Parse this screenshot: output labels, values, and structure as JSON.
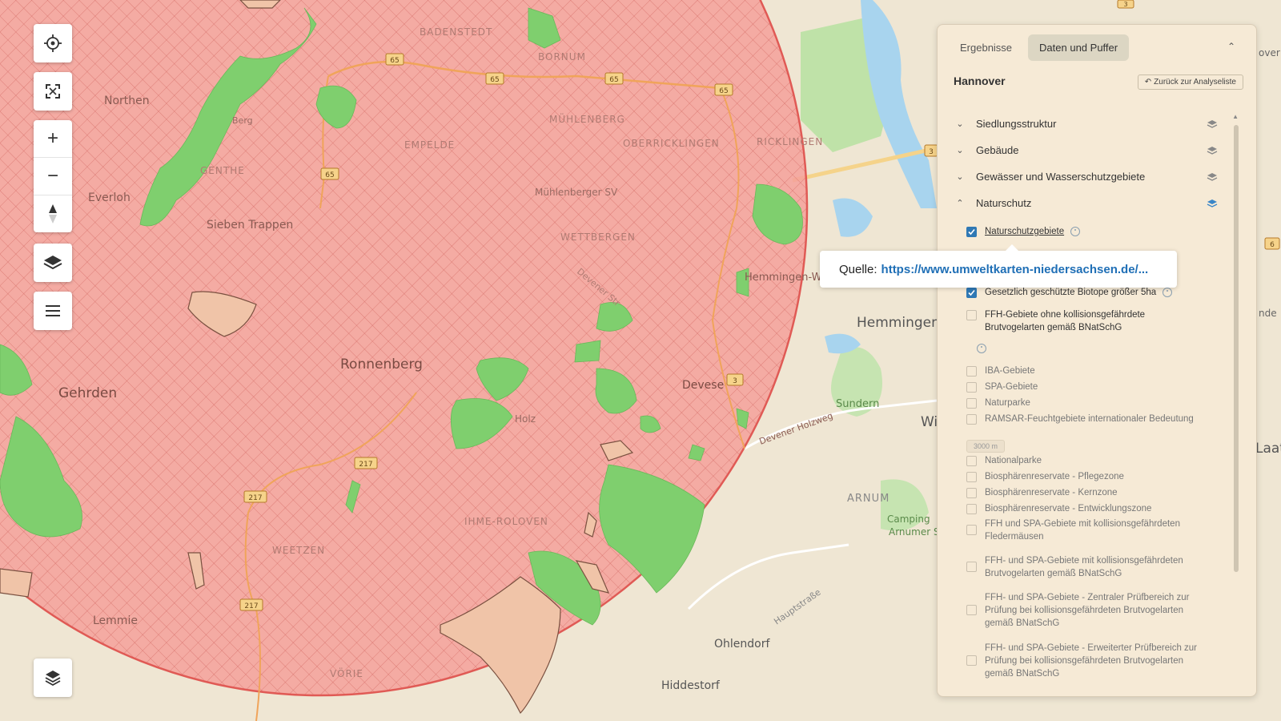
{
  "map": {
    "place_labels": [
      {
        "id": "badenstedt",
        "text": "BADENSTEDT"
      },
      {
        "id": "bornum",
        "text": "BORNUM"
      },
      {
        "id": "northen",
        "text": "Northen"
      },
      {
        "id": "berg",
        "text": "Berg"
      },
      {
        "id": "muhlenberg",
        "text": "MÜHLENBERG"
      },
      {
        "id": "empelde",
        "text": "EMPELDE"
      },
      {
        "id": "oberricklingen",
        "text": "OBERRICKLINGEN"
      },
      {
        "id": "ricklingen",
        "text": "RICKLINGEN"
      },
      {
        "id": "gehrden",
        "text": "Gehrden"
      },
      {
        "id": "genthe",
        "text": "GENTHE"
      },
      {
        "id": "everloh",
        "text": "Everloh"
      },
      {
        "id": "sieben_trappen",
        "text": "Sieben Trappen"
      },
      {
        "id": "muhlenberger_sv",
        "text": "Mühlenberger SV"
      },
      {
        "id": "wettbergen",
        "text": "WETTBERGEN"
      },
      {
        "id": "hemmingen_westerfeld",
        "text": "Hemmingen-Westerfeld"
      },
      {
        "id": "hemmingen",
        "text": "Hemmingen"
      },
      {
        "id": "ronnenberg",
        "text": "Ronnenberg"
      },
      {
        "id": "devese",
        "text": "Devese"
      },
      {
        "id": "holz",
        "text": "Holz"
      },
      {
        "id": "sundern",
        "text": "Sundern"
      },
      {
        "id": "arnum",
        "text": "ARNUM"
      },
      {
        "id": "camping",
        "text": "Camping"
      },
      {
        "id": "arnumer",
        "text": "Arnumer S"
      },
      {
        "id": "ihme_roloven",
        "text": "IHME-ROLOVEN"
      },
      {
        "id": "weetzen",
        "text": "WEETZEN"
      },
      {
        "id": "lemmie",
        "text": "Lemmie"
      },
      {
        "id": "vorie",
        "text": "VÖRIE"
      },
      {
        "id": "ohlendorf",
        "text": "Ohlendorf"
      },
      {
        "id": "hiddestorf",
        "text": "Hiddestorf"
      },
      {
        "id": "hauptstrasse",
        "text": "Hauptstraße"
      },
      {
        "id": "holzweg",
        "text": "Devener Holzweg"
      },
      {
        "id": "devener_str",
        "text": "Devener Str"
      },
      {
        "id": "laat",
        "text": "Laat"
      },
      {
        "id": "wi",
        "text": "Wi"
      },
      {
        "id": "over",
        "text": "over"
      },
      {
        "id": "nde",
        "text": "nde"
      }
    ],
    "road_shields": [
      "65",
      "65",
      "65",
      "65",
      "65",
      "217",
      "217",
      "217",
      "3",
      "3",
      "3",
      "6"
    ],
    "colors": {
      "base": "#efe6d3",
      "buffer_fill": "#f4a09a",
      "buffer_stroke": "#e05a55",
      "green": "#7fcf6e",
      "water": "#a8d4ee",
      "road": "#f5b667"
    }
  },
  "controls": {
    "locate_icon": "crosshair-icon",
    "fullscreen_icon": "expand-icon",
    "zoom_in": "+",
    "zoom_out": "−",
    "compass_icon": "compass-icon",
    "layers_icon": "layers-icon",
    "menu_icon": "menu-icon",
    "basemap_icon": "layers-icon"
  },
  "panel": {
    "tabs": [
      {
        "label": "Ergebnisse",
        "active": false
      },
      {
        "label": "Daten und Puffer",
        "active": true
      }
    ],
    "title": "Hannover",
    "back_label": "Zurück zur Analyseliste",
    "sections": [
      {
        "label": "Siedlungsstruktur",
        "expanded": false
      },
      {
        "label": "Gebäude",
        "expanded": false
      },
      {
        "label": "Gewässer und Wasserschutzgebiete",
        "expanded": false
      },
      {
        "label": "Naturschutz",
        "expanded": true
      }
    ],
    "items": [
      {
        "label": "Naturschutzgebiete",
        "checked": true
      },
      {
        "label": "Gesetzlich geschützte Biotope größer 5ha",
        "checked": true
      },
      {
        "label": "FFH-Gebiete ohne kollisionsgefährdete Brutvogelarten gemäß BNatSchG",
        "checked": false
      },
      {
        "label": "IBA-Gebiete",
        "checked": false
      },
      {
        "label": "SPA-Gebiete",
        "checked": false
      },
      {
        "label": "Naturparke",
        "checked": false
      },
      {
        "label": "RAMSAR-Feuchtgebiete internationaler Bedeutung",
        "checked": false
      },
      {
        "label": "Nationalparke",
        "checked": false
      },
      {
        "label": "Biosphärenreservate - Pflegezone",
        "checked": false
      },
      {
        "label": "Biosphärenreservate - Kernzone",
        "checked": false
      },
      {
        "label": "Biosphärenreservate - Entwicklungszone",
        "checked": false
      },
      {
        "label": "FFH und SPA-Gebiete mit kollisionsgefährdeten Fledermäusen",
        "checked": false
      },
      {
        "label": "FFH- und SPA-Gebiete mit kollisionsgefährdeten Brutvogelarten gemäß BNatSchG",
        "checked": false
      },
      {
        "label": "FFH- und SPA-Gebiete - Zentraler Prüfbereich zur Prüfung bei kollisionsgefährdeten Brutvogelarten gemäß BNatSchG",
        "checked": false
      },
      {
        "label": "FFH- und SPA-Gebiete - Erweiterter Prüfbereich zur Prüfung bei kollisionsgefährdeten Brutvogelarten gemäß BNatSchG",
        "checked": false
      }
    ],
    "buffer_value": "3000 m"
  },
  "tooltip": {
    "prefix": "Quelle:",
    "link": "https://www.umweltkarten-niedersachsen.de/..."
  }
}
